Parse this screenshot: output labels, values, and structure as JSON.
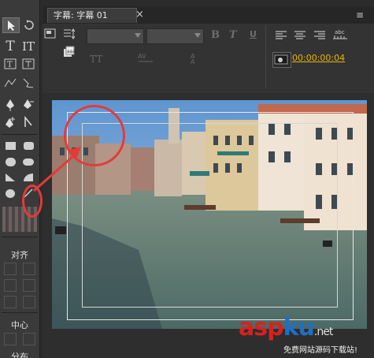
{
  "tab": {
    "label": "字幕: 字幕 01",
    "close_glyph": "×"
  },
  "panel_menu_glyph": "≡",
  "toolbar": {
    "font_family_value": "",
    "font_style_value": "",
    "bold_label": "B",
    "italic_label": "T",
    "underline_label": "U",
    "timecode": "00:00:00:04",
    "timecode_color": "#e8b600"
  },
  "tools_panel": {
    "align_section": "对齐",
    "center_section": "中心",
    "distribute_section": "分布"
  },
  "watermark": {
    "brand_asp": "asp",
    "brand_ku": "ku",
    "brand_suffix": ".net",
    "tagline": "免费网站源码下载站!"
  },
  "colors": {
    "annotation_red": "#e53a3a",
    "accent_red": "#d92020",
    "accent_blue": "#1f6fc4"
  }
}
